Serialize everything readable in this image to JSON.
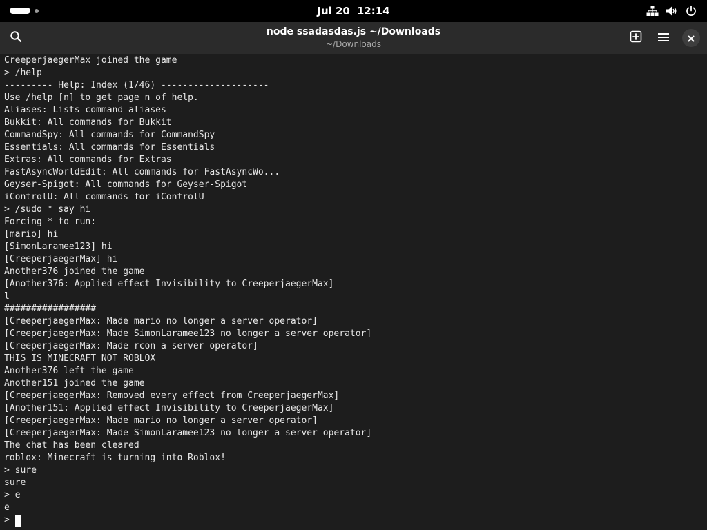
{
  "topbar": {
    "date": "Jul 20",
    "time": "12:14",
    "icons": [
      "activities-indicator",
      "network-icon",
      "volume-icon",
      "power-icon"
    ]
  },
  "window": {
    "title": "node ssadasdas.js ~/Downloads",
    "subtitle": "~/Downloads",
    "icons": [
      "search-icon",
      "new-tab-icon",
      "hamburger-menu-icon",
      "close-icon"
    ]
  },
  "terminal": {
    "lines": [
      "CreeperjaegerMax joined the game",
      "> /help",
      "--------- Help: Index (1/46) --------------------",
      "Use /help [n] to get page n of help.",
      "Aliases: Lists command aliases",
      "Bukkit: All commands for Bukkit",
      "CommandSpy: All commands for CommandSpy",
      "Essentials: All commands for Essentials",
      "Extras: All commands for Extras",
      "FastAsyncWorldEdit: All commands for FastAsyncWo...",
      "Geyser-Spigot: All commands for Geyser-Spigot",
      "iControlU: All commands for iControlU",
      "> /sudo * say hi",
      "Forcing * to run:",
      "[mario] hi",
      "[SimonLaramee123] hi",
      "[CreeperjaegerMax] hi",
      "Another376 joined the game",
      "[Another376: Applied effect Invisibility to CreeperjaegerMax]",
      "l",
      "#################",
      "[CreeperjaegerMax: Made mario no longer a server operator]",
      "[CreeperjaegerMax: Made SimonLaramee123 no longer a server operator]",
      "[CreeperjaegerMax: Made rcon a server operator]",
      "THIS IS MINECRAFT NOT ROBLOX",
      "Another376 left the game",
      "Another151 joined the game",
      "[CreeperjaegerMax: Removed every effect from CreeperjaegerMax]",
      "[Another151: Applied effect Invisibility to CreeperjaegerMax]",
      "[CreeperjaegerMax: Made mario no longer a server operator]",
      "[CreeperjaegerMax: Made SimonLaramee123 no longer a server operator]",
      "The chat has been cleared",
      "roblox: Minecraft is turning into Roblox!",
      "> sure",
      "sure",
      "> e",
      "e"
    ],
    "prompt": "> "
  },
  "colors": {
    "topbar_bg": "#000000",
    "headerbar_bg": "#2b2b2b",
    "terminal_bg": "#1d1d1d",
    "terminal_fg": "#e6e6e6",
    "subtitle_fg": "#a8a8a8"
  }
}
